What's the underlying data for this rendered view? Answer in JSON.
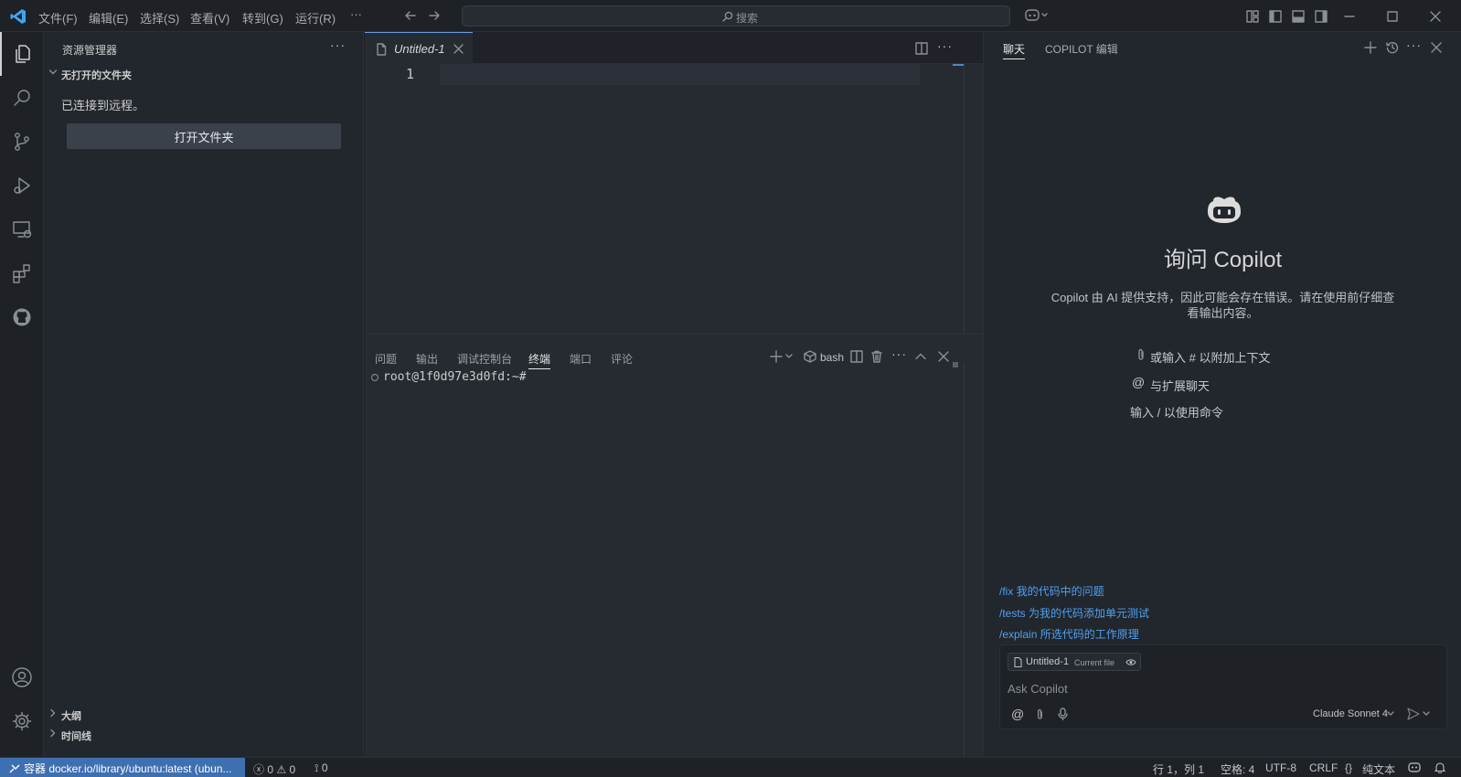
{
  "menu": [
    "文件(F)",
    "编辑(E)",
    "选择(S)",
    "查看(V)",
    "转到(G)",
    "运行(R)",
    "···"
  ],
  "search": {
    "label": "搜索"
  },
  "sidebar": {
    "title": "资源管理器",
    "section_no_folder": "无打开的文件夹",
    "connected_text": "已连接到远程。",
    "open_folder_button": "打开文件夹",
    "section_outline": "大纲",
    "section_timeline": "时间线"
  },
  "editor": {
    "tab_title": "Untitled-1",
    "line_number": "1"
  },
  "panel": {
    "tabs": [
      "问题",
      "输出",
      "调试控制台",
      "终端",
      "端口",
      "评论"
    ],
    "active_tab": "终端",
    "shell_label": "bash",
    "prompt": "root@1f0d97e3d0fd:~#"
  },
  "chat": {
    "tabs": [
      "聊天",
      "COPILOT 编辑"
    ],
    "title": "询问 Copilot",
    "description": "Copilot 由 AI 提供支持，因此可能会存在错误。请在使用前仔细查看输出内容。",
    "hint_attach": "或输入 # 以附加上下文",
    "hint_extensions": "与扩展聊天",
    "hint_commands": "输入 / 以使用命令",
    "suggestions": [
      {
        "cmd": "/fix",
        "text": " 我的代码中的问题"
      },
      {
        "cmd": "/tests",
        "text": " 为我的代码添加单元测试"
      },
      {
        "cmd": "/explain",
        "text": " 所选代码的工作原理"
      }
    ],
    "context_file": "Untitled-1",
    "context_label": "Current file",
    "input_placeholder": "Ask Copilot",
    "model": "Claude Sonnet 4"
  },
  "statusbar": {
    "remote": "容器 docker.io/library/ubuntu:latest (ubun...",
    "errors": "0",
    "warnings": "0",
    "ports": "0",
    "position": "行 1，列 1",
    "spaces": "空格: 4",
    "encoding": "UTF-8",
    "eol": "CRLF",
    "language": "纯文本"
  },
  "colors": {
    "accent": "#3e6fb0",
    "link": "#4fa1f0",
    "background": "#22262d",
    "editor": "#262a31"
  }
}
